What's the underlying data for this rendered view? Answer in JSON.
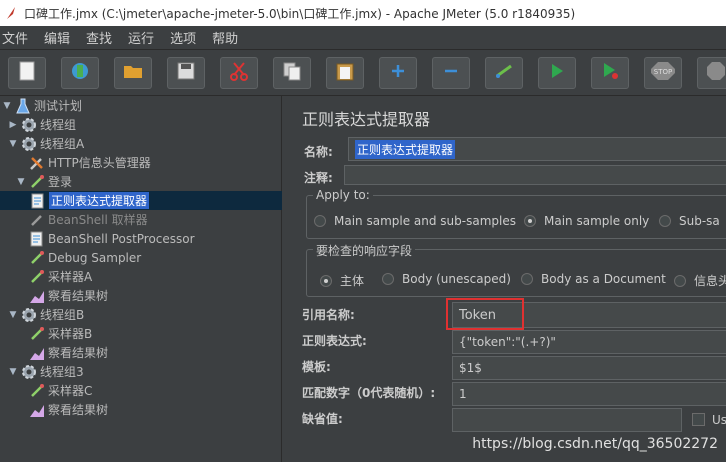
{
  "window": {
    "title": "口碑工作.jmx (C:\\jmeter\\apache-jmeter-5.0\\bin\\口碑工作.jmx) - Apache JMeter (5.0 r1840935)"
  },
  "menu": [
    "文件",
    "编辑",
    "查找",
    "运行",
    "选项",
    "帮助"
  ],
  "toolbar": {
    "buttons": [
      {
        "icon": "new-file-icon"
      },
      {
        "icon": "templates-icon"
      },
      {
        "icon": "open-folder-icon"
      },
      {
        "icon": "save-icon"
      },
      {
        "icon": "cut-icon"
      },
      {
        "icon": "copy-icon"
      },
      {
        "icon": "paste-icon"
      },
      {
        "icon": "expand-icon"
      },
      {
        "icon": "collapse-icon"
      },
      {
        "icon": "toggle-icon"
      },
      {
        "icon": "start-icon"
      },
      {
        "icon": "start-no-pause-icon"
      },
      {
        "icon": "stop-icon"
      },
      {
        "icon": "shutdown-icon"
      }
    ],
    "stop_label": "STOP"
  },
  "tree": [
    {
      "label": "测试计划",
      "level": 0,
      "toggle": "▼",
      "icon": "flask-icon"
    },
    {
      "label": "线程组",
      "level": 1,
      "toggle": "▶",
      "icon": "gear-icon"
    },
    {
      "label": "线程组A",
      "level": 1,
      "toggle": "▼",
      "icon": "gear-icon"
    },
    {
      "label": "HTTP信息头管理器",
      "level": 2,
      "toggle": "",
      "icon": "wrench-icon"
    },
    {
      "label": "登录",
      "level": 2,
      "toggle": "▼",
      "icon": "pipette-icon"
    },
    {
      "label": "正则表达式提取器",
      "level": 3,
      "toggle": "",
      "icon": "extractor-icon",
      "selected": true
    },
    {
      "label": "BeanShell 取样器",
      "level": 2,
      "toggle": "",
      "icon": "pipette-icon",
      "disabled": true
    },
    {
      "label": "BeanShell PostProcessor",
      "level": 2,
      "toggle": "",
      "icon": "extractor-icon"
    },
    {
      "label": "Debug Sampler",
      "level": 2,
      "toggle": "",
      "icon": "pipette-icon"
    },
    {
      "label": "采样器A",
      "level": 2,
      "toggle": "",
      "icon": "pipette-icon"
    },
    {
      "label": "察看结果树",
      "level": 2,
      "toggle": "",
      "icon": "chart-icon"
    },
    {
      "label": "线程组B",
      "level": 1,
      "toggle": "▼",
      "icon": "gear-icon"
    },
    {
      "label": "采样器B",
      "level": 2,
      "toggle": "",
      "icon": "pipette-icon"
    },
    {
      "label": "察看结果树",
      "level": 2,
      "toggle": "",
      "icon": "chart-icon"
    },
    {
      "label": "线程组3",
      "level": 1,
      "toggle": "▼",
      "icon": "gear-icon"
    },
    {
      "label": "采样器C",
      "level": 2,
      "toggle": "",
      "icon": "pipette-icon"
    },
    {
      "label": "察看结果树",
      "level": 2,
      "toggle": "",
      "icon": "chart-icon"
    }
  ],
  "panel": {
    "title": "正则表达式提取器",
    "name_label": "名称:",
    "name_value": "正则表达式提取器",
    "comment_label": "注释:",
    "apply_to": {
      "legend": "Apply to:",
      "options": [
        "Main sample and sub-samples",
        "Main sample only",
        "Sub-sa"
      ],
      "selected": "Main sample only"
    },
    "field_check": {
      "legend": "要检查的响应字段",
      "options": [
        "主体",
        "Body (unescaped)",
        "Body as a Document",
        "信息头"
      ],
      "selected": "主体"
    },
    "ref_name_label": "引用名称:",
    "ref_name_value": "Token",
    "regex_label": "正则表达式:",
    "regex_value": "{\"token\":\"(.+?)\"",
    "template_label": "模板:",
    "template_value": "$1$",
    "match_no_label": "匹配数字（0代表随机）:",
    "match_no_value": "1",
    "default_label": "缺省值:",
    "default_value": "",
    "use_empty_label": "Us"
  },
  "watermark": "https://blog.csdn.net/qq_36502272"
}
